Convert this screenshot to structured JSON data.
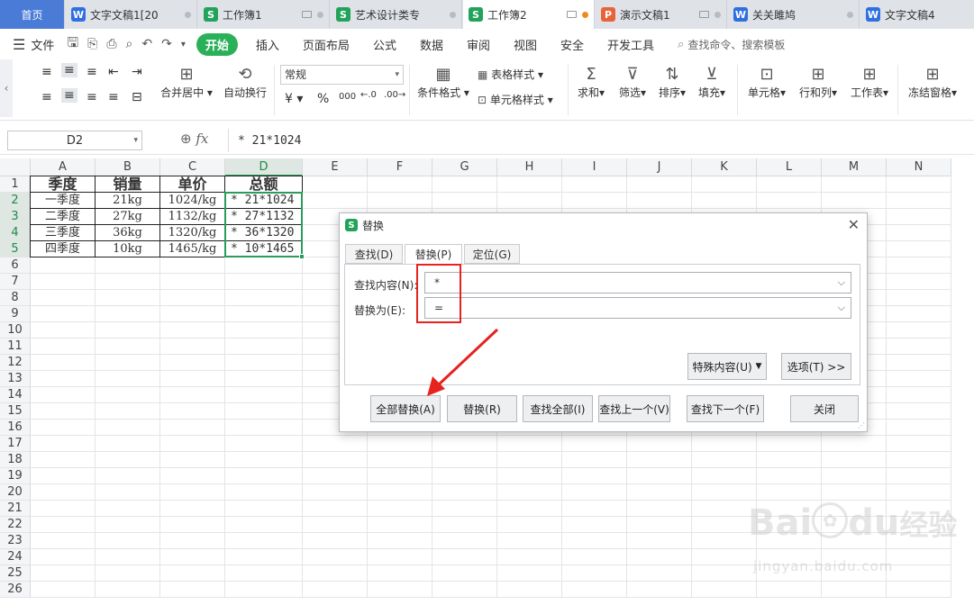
{
  "tabs": [
    {
      "label": "首页",
      "type": "home"
    },
    {
      "label": "文字文稿1[20",
      "icon": "W"
    },
    {
      "label": "工作簿1",
      "icon": "S"
    },
    {
      "label": "艺术设计类专",
      "icon": "S"
    },
    {
      "label": "工作簿2",
      "icon": "S"
    },
    {
      "label": "演示文稿1",
      "icon": "P"
    },
    {
      "label": "关关雎鸠",
      "icon": "W"
    },
    {
      "label": "文字文稿4",
      "icon": "W"
    }
  ],
  "menu": {
    "file": "文件",
    "items": [
      "开始",
      "插入",
      "页面布局",
      "公式",
      "数据",
      "审阅",
      "视图",
      "安全",
      "开发工具"
    ],
    "search": "查找命令、搜索模板"
  },
  "ribbon": {
    "merge": "合并居中",
    "wrap": "自动换行",
    "number_format": "常规",
    "percent": "%",
    "thousands": "000",
    "cond_format": "条件格式",
    "table_style": "表格样式",
    "cell_style": "单元格样式",
    "sum": "求和",
    "filter": "筛选",
    "sort": "排序",
    "fill": "填充",
    "cell": "单元格",
    "rowcol": "行和列",
    "sheet": "工作表",
    "freeze": "冻结窗格"
  },
  "formula": {
    "namebox": "D2",
    "fx": "fx",
    "content": "* 21*1024"
  },
  "columns": [
    "A",
    "B",
    "C",
    "D",
    "E",
    "F",
    "G",
    "H",
    "I",
    "J",
    "K",
    "L",
    "M",
    "N"
  ],
  "rows": [
    "1",
    "2",
    "3",
    "4",
    "5",
    "6",
    "7",
    "8",
    "9",
    "10",
    "11",
    "12",
    "13",
    "14",
    "15",
    "16",
    "17",
    "18",
    "19",
    "20",
    "21",
    "22",
    "23",
    "24",
    "25",
    "26"
  ],
  "sheet": {
    "headers": [
      "季度",
      "销量",
      "单价",
      "总额"
    ],
    "data": [
      [
        "一季度",
        "21kg",
        "1024/kg",
        "* 21*1024"
      ],
      [
        "二季度",
        "27kg",
        "1132/kg",
        "* 27*1132"
      ],
      [
        "三季度",
        "36kg",
        "1320/kg",
        "* 36*1320"
      ],
      [
        "四季度",
        "10kg",
        "1465/kg",
        "* 10*1465"
      ]
    ]
  },
  "dialog": {
    "title": "替换",
    "tabs": [
      "查找(D)",
      "替换(P)",
      "定位(G)"
    ],
    "find_label": "查找内容(N):",
    "find_value": "*",
    "replace_label": "替换为(E):",
    "replace_value": "=",
    "special": "特殊内容(U)",
    "options": "选项(T) >>",
    "buttons": [
      "全部替换(A)",
      "替换(R)",
      "查找全部(I)",
      "查找上一个(V)",
      "查找下一个(F)",
      "关闭"
    ]
  },
  "watermark": {
    "brand": "Bai",
    "brand2": "du",
    "cn": "经验",
    "url": "jingyan.baidu.com"
  }
}
